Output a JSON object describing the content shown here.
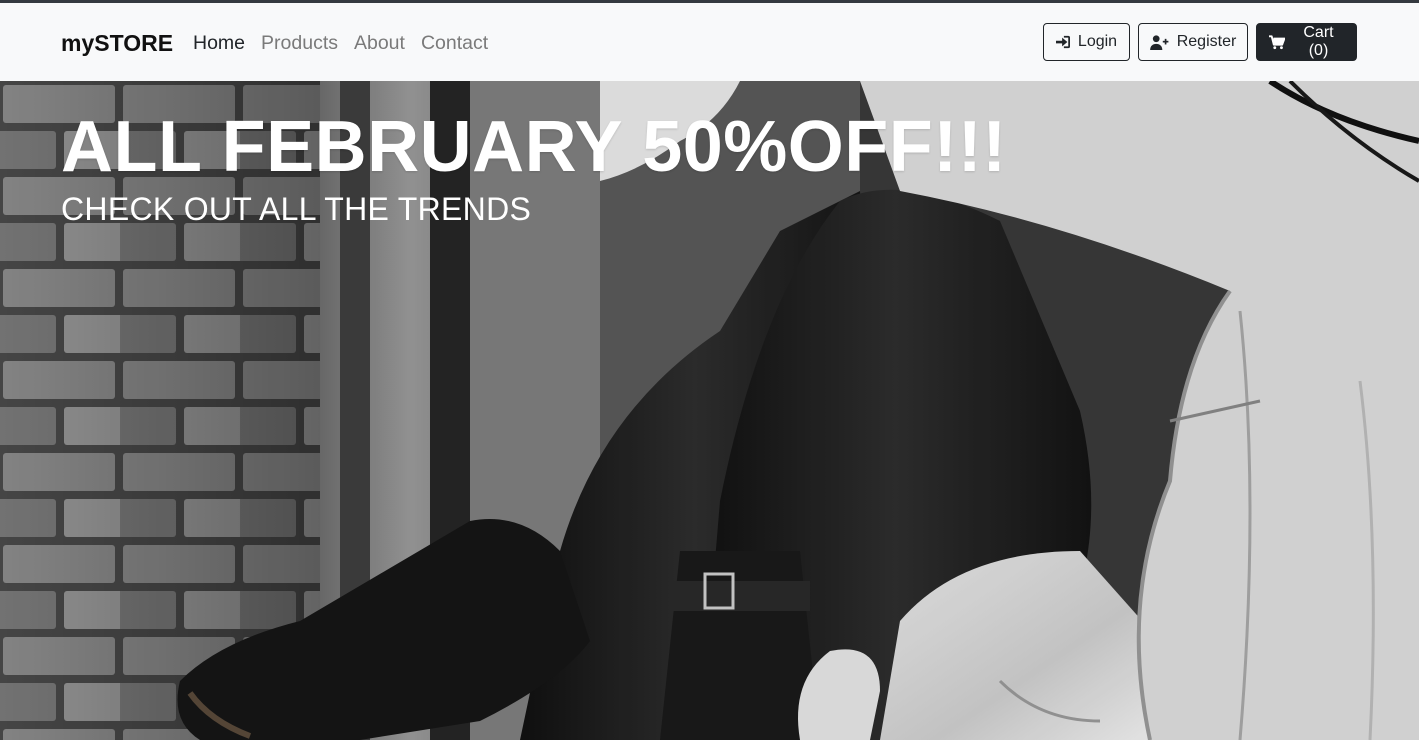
{
  "navbar": {
    "brand": "mySTORE",
    "links": [
      {
        "label": "Home",
        "active": true
      },
      {
        "label": "Products",
        "active": false
      },
      {
        "label": "About",
        "active": false
      },
      {
        "label": "Contact",
        "active": false
      }
    ],
    "buttons": {
      "login": {
        "label": "Login",
        "icon": "sign-in-icon"
      },
      "register": {
        "label": "Register",
        "icon": "user-plus-icon"
      },
      "cart": {
        "label": "Cart (0)",
        "icon": "cart-icon"
      }
    }
  },
  "hero": {
    "title": "ALL FEBRUARY 50%OFF!!!",
    "subtitle": "CHECK OUT ALL THE TRENDS",
    "image": "black-and-white-fashion-photo"
  },
  "colors": {
    "navbar_bg": "#f8f9fa",
    "dark": "#212529",
    "muted_link": "#7a7a7a",
    "hero_text": "#ffffff"
  }
}
